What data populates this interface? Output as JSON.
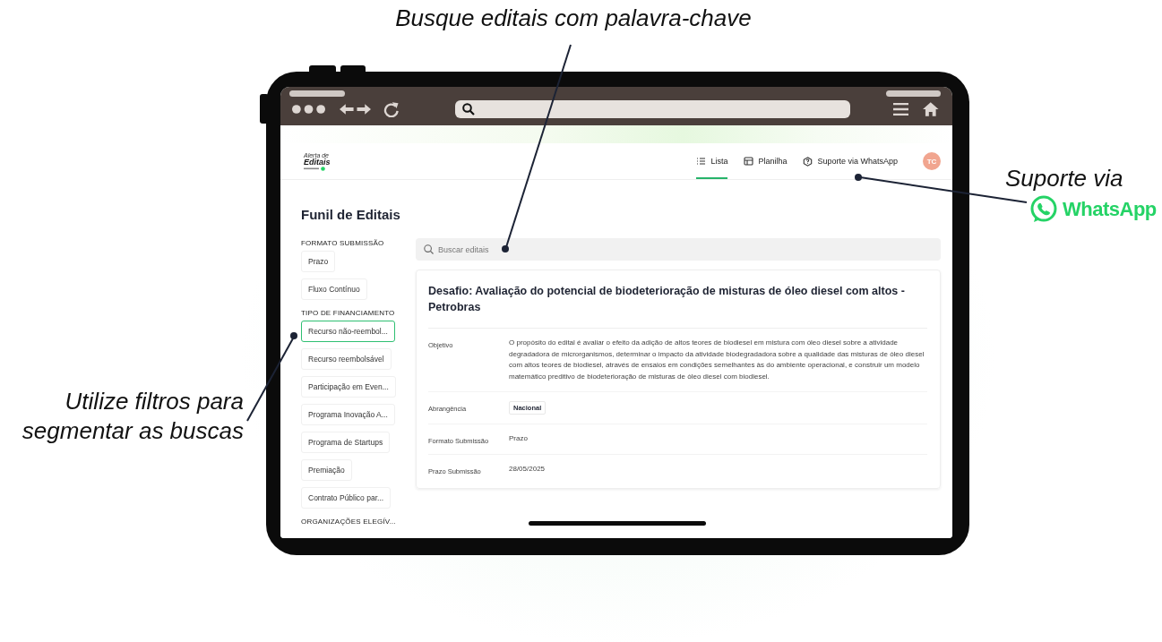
{
  "annotations": [
    {
      "kind": "top",
      "text": "Busque editais com palavra-chave"
    },
    {
      "kind": "right",
      "text": "Suporte via",
      "brand": "WhatsApp"
    },
    {
      "kind": "left",
      "text": "Utilize filtros para segmentar as buscas"
    }
  ],
  "app": {
    "logo": {
      "line_1": "Alerta de",
      "line_2": "Editais"
    },
    "nav": [
      {
        "kind": "list",
        "label": "Lista",
        "selected": true
      },
      {
        "kind": "table",
        "label": "Planilha",
        "selected": false
      },
      {
        "kind": "help",
        "label": "Suporte via WhatsApp",
        "selected": false
      }
    ],
    "avatar": "TC"
  },
  "sidebar": {
    "title": "Funil de Editais",
    "groups": [
      {
        "heading": "FORMATO SUBMISSÃO",
        "filters": [
          {
            "label": "Prazo",
            "selected": false
          },
          {
            "label": "Fluxo Contínuo",
            "selected": false
          }
        ]
      },
      {
        "heading": "TIPO DE FINANCIAMENTO",
        "filters": [
          {
            "label": "Recurso não-reembol...",
            "selected": true
          },
          {
            "label": "Recurso reembolsável",
            "selected": false
          },
          {
            "label": "Participação em Even...",
            "selected": false
          },
          {
            "label": "Programa Inovação A...",
            "selected": false
          },
          {
            "label": "Programa de Startups",
            "selected": false
          },
          {
            "label": "Premiação",
            "selected": false
          },
          {
            "label": "Contrato Público par...",
            "selected": false
          }
        ]
      },
      {
        "heading": "ORGANIZAÇÕES ELEGÍV..."
      }
    ]
  },
  "search": {
    "placeholder": "Buscar editais"
  },
  "card": {
    "title": "Desafio: Avaliação do potencial de biodeterioração de misturas de óleo diesel com altos - Petrobras",
    "fields": [
      {
        "label": "Objetivo",
        "kind": "text",
        "value": "O propósito do edital é avaliar o efeito da adição de altos teores de biodiesel em mistura com óleo diesel sobre a atividade degradadora de microrganismos, determinar o impacto da atividade biodegradadora sobre a qualidade das misturas de óleo diesel com altos teores de biodiesel, através de ensaios em condições semelhantes às do ambiente operacional, e construir um modelo matemático preditivo de biodeterioração de misturas de óleo diesel com biodiesel."
      },
      {
        "label": "Abrangência",
        "kind": "tag",
        "value": "Nacional"
      },
      {
        "label": "Formato Submissão",
        "kind": "text",
        "value": "Prazo"
      },
      {
        "label": "Prazo Submissão",
        "kind": "text",
        "value": "28/05/2025"
      }
    ]
  }
}
